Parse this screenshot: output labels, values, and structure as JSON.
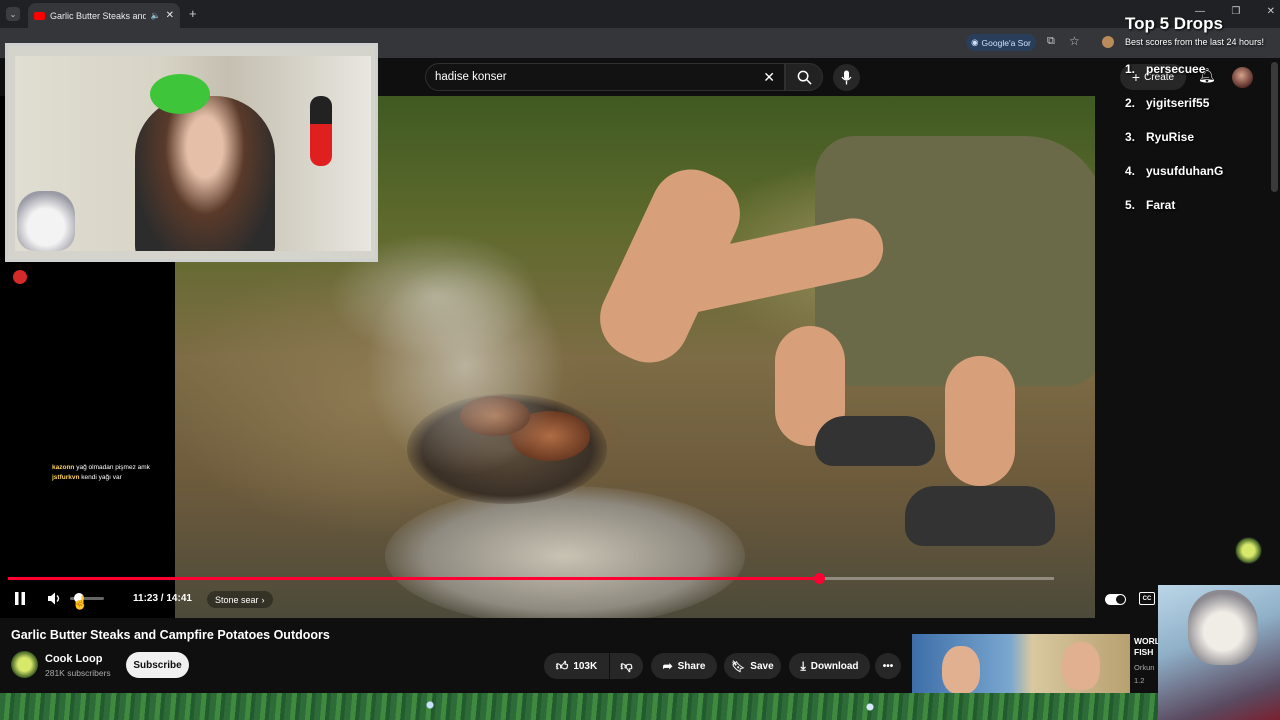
{
  "browser": {
    "tab_title": "Garlic Butter Steaks and Campfire Potatoes Outdoors",
    "new_tab_symbol": "+",
    "google_button": "Google'a Sor"
  },
  "youtube": {
    "search_query": "hadise konser",
    "create_label": "Create"
  },
  "player": {
    "current_time": "11:23",
    "duration": "14:41",
    "progress_fraction": 0.775,
    "chapter_label": "Stone sear"
  },
  "video": {
    "title": "Garlic Butter Steaks and Campfire Potatoes Outdoors",
    "channel_name": "Cook Loop",
    "subscribers": "281K subscribers",
    "subscribe_label": "Subscribe",
    "like_count": "103K",
    "share_label": "Share",
    "save_label": "Save",
    "download_label": "Download"
  },
  "suggested": {
    "title_line1": "WORL",
    "title_line2": "FISH",
    "channel": "Orkun",
    "views": "1.2"
  },
  "leaderboard": {
    "title": "Top 5 Drops",
    "subtitle": "Best scores from the last 24 hours!",
    "entries": [
      {
        "rank": "1.",
        "name": "persecuee"
      },
      {
        "rank": "2.",
        "name": "yigitserif55"
      },
      {
        "rank": "3.",
        "name": "RyuRise"
      },
      {
        "rank": "4.",
        "name": "yusufduhanG"
      },
      {
        "rank": "5.",
        "name": "Farat"
      }
    ]
  },
  "chat": [
    {
      "user": "kazonn",
      "message": "yağ olmadan pişmez amk"
    },
    {
      "user": "jstfurkvn",
      "message": "kendi yağı var"
    }
  ],
  "colors": {
    "accent": "#ff0033",
    "background": "#0f0f0f"
  }
}
